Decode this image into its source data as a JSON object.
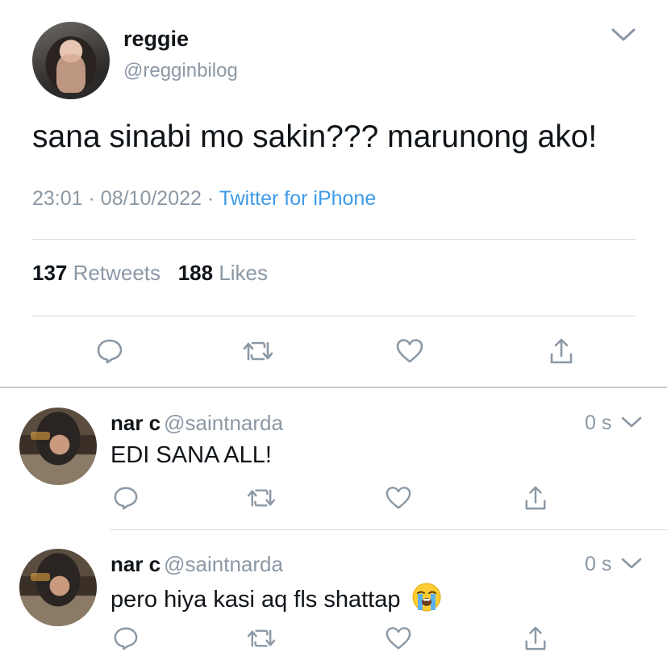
{
  "main_tweet": {
    "author_name": "reggie",
    "author_handle": "@regginbilog",
    "text": "sana sinabi mo sakin??? marunong ako!",
    "time": "23:01",
    "date": "08/10/2022",
    "source": "Twitter for iPhone",
    "retweet_count": "137",
    "retweet_label": "Retweets",
    "like_count": "188",
    "like_label": "Likes"
  },
  "replies": [
    {
      "name": "nar c",
      "handle": "@saintnarda",
      "time": "0 s",
      "text": "EDI SANA ALL!"
    },
    {
      "name": "nar c",
      "handle": "@saintnarda",
      "time": "0 s",
      "text": "pero hiya kasi aq fls shattap",
      "emoji": "loudly-crying-face"
    }
  ],
  "icons": [
    "reply-icon",
    "retweet-icon",
    "like-icon",
    "share-icon",
    "chevron-down-icon"
  ],
  "colors": {
    "text": "#0f1419",
    "secondary": "#8b98a5",
    "link": "#3d9ae8",
    "divider": "#d6dadf"
  }
}
